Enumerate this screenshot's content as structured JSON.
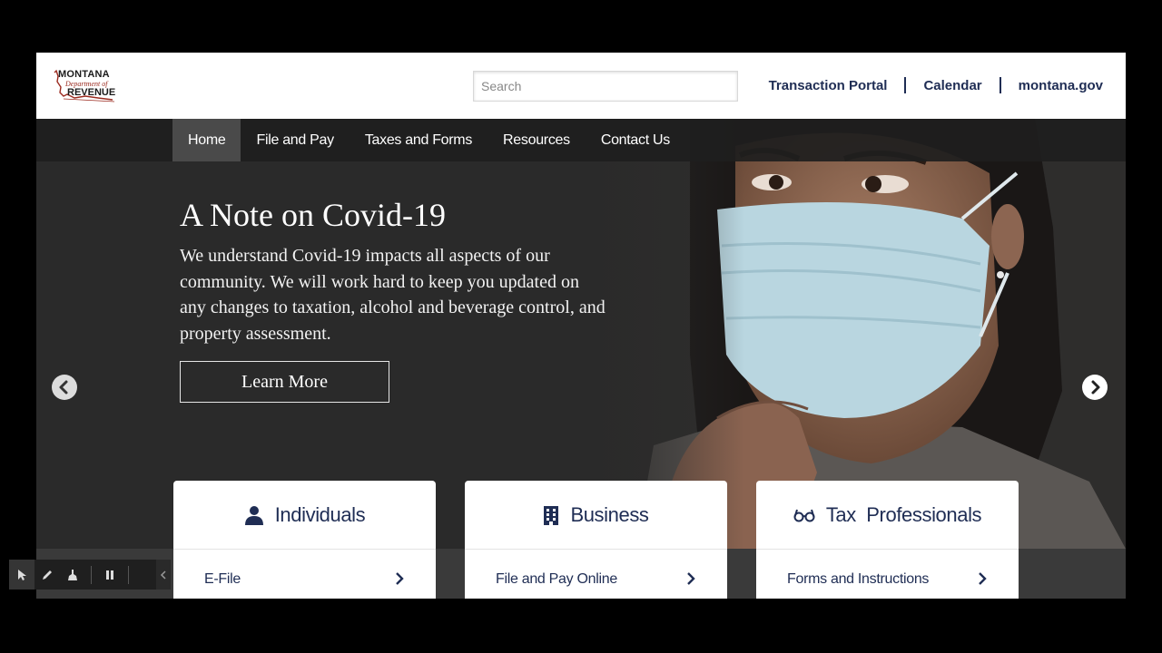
{
  "header": {
    "logo": {
      "line1": "MONTANA",
      "line2": "Department of",
      "line3": "REVENUE"
    },
    "search_placeholder": "Search",
    "search_value": "",
    "links": [
      "Transaction Portal",
      "Calendar",
      "montana.gov"
    ]
  },
  "nav": {
    "items": [
      "Home",
      "File and Pay",
      "Taxes and Forms",
      "Resources",
      "Contact Us"
    ],
    "active": "Home"
  },
  "hero": {
    "title": "A Note on Covid-19",
    "body": "We understand Covid-19 impacts all aspects of our community. We will work hard to keep you updated on any changes to taxation, alcohol and beverage control, and property assessment.",
    "button": "Learn More"
  },
  "cards": [
    {
      "title": "Individuals",
      "icon": "person-icon",
      "link": "E-File"
    },
    {
      "title": "Business",
      "icon": "building-icon",
      "link": "File and Pay Online"
    },
    {
      "title": "Tax  Professionals",
      "icon": "glasses-icon",
      "link": "Forms and Instructions"
    }
  ],
  "colors": {
    "brand_navy": "#1f2d54",
    "nav_bg": "#1e1e1e",
    "hero_bg": "#2a2a2a"
  },
  "toolbar": {
    "icons": [
      "cursor-icon",
      "pencil-icon",
      "broom-icon",
      "pause-icon",
      "chevron-left-icon"
    ]
  }
}
